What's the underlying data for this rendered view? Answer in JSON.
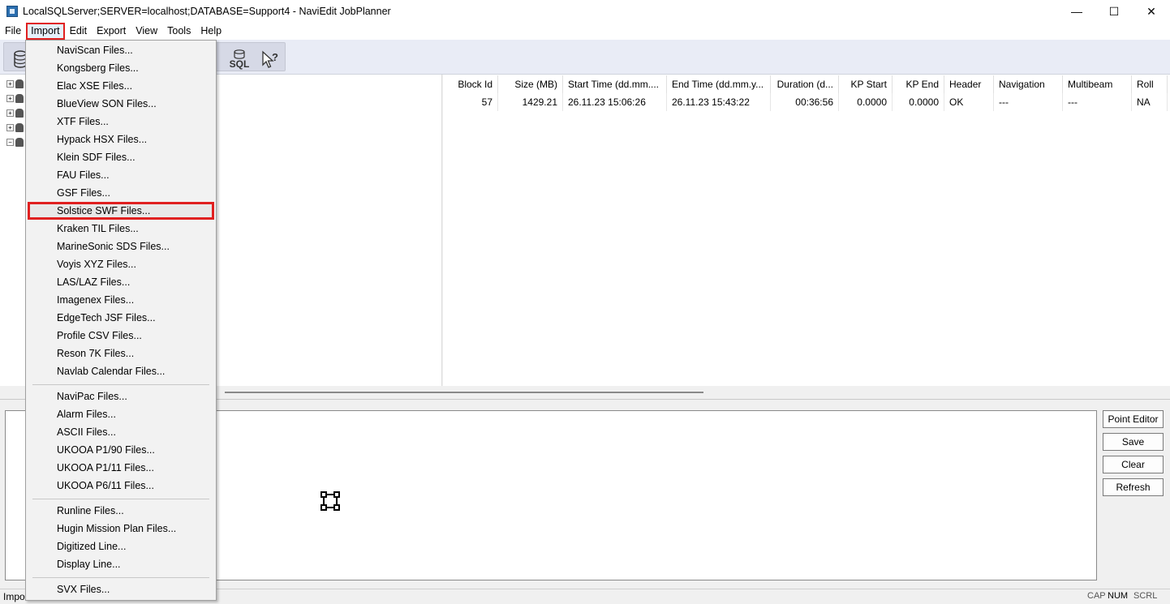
{
  "window": {
    "title": "LocalSQLServer;SERVER=localhost;DATABASE=Support4 - NaviEdit JobPlanner",
    "minimize_glyph": "—",
    "maximize_glyph": "☐",
    "close_glyph": "✕"
  },
  "menubar": {
    "items": [
      "File",
      "Import",
      "Edit",
      "Export",
      "View",
      "Tools",
      "Help"
    ],
    "active": "Import"
  },
  "toolbar": {
    "icons": [
      "database-icon",
      "sql-database-icon",
      "whats-this-help-icon"
    ],
    "sql_label": "SQL"
  },
  "import_menu": {
    "group1": [
      "NaviScan Files...",
      "Kongsberg Files...",
      "Elac XSE Files...",
      "BlueView SON Files...",
      "XTF Files...",
      "Hypack HSX Files...",
      "Klein SDF Files...",
      "FAU Files...",
      "GSF Files...",
      "Solstice SWF Files...",
      "Kraken TIL Files...",
      "MarineSonic SDS Files...",
      "Voyis XYZ Files...",
      "LAS/LAZ Files...",
      "Imagenex Files...",
      "EdgeTech JSF Files...",
      "Profile CSV Files...",
      "Reson 7K Files...",
      "Navlab Calendar Files..."
    ],
    "group2": [
      "NaviPac Files...",
      "Alarm Files...",
      "ASCII Files...",
      "UKOOA P1/90 Files...",
      "UKOOA P1/11 Files...",
      "UKOOA P6/11 Files..."
    ],
    "group3": [
      "Runline Files...",
      "Hugin Mission Plan Files...",
      "Digitized Line...",
      "Display Line..."
    ],
    "group4": [
      "SVX Files..."
    ],
    "highlighted": "Solstice SWF Files..."
  },
  "grid": {
    "columns": [
      "Block Id",
      "Size (MB)",
      "Start Time (dd.mm....",
      "End Time (dd.mm.y...",
      "Duration (d...",
      "KP Start",
      "KP End",
      "Header",
      "Navigation",
      "Multibeam",
      "Roll"
    ],
    "rows": [
      [
        "57",
        "1429.21",
        "26.11.23 15:06:26",
        "26.11.23 15:43:22",
        "00:36:56",
        "0.0000",
        "0.0000",
        "OK",
        "---",
        "---",
        "NA"
      ]
    ]
  },
  "side_buttons": {
    "point_editor": "Point Editor",
    "save": "Save",
    "clear": "Clear",
    "refresh": "Refresh"
  },
  "statusbar": {
    "text": "Impor",
    "cap": "CAP",
    "num": "NUM",
    "scrl": "SCRL"
  }
}
